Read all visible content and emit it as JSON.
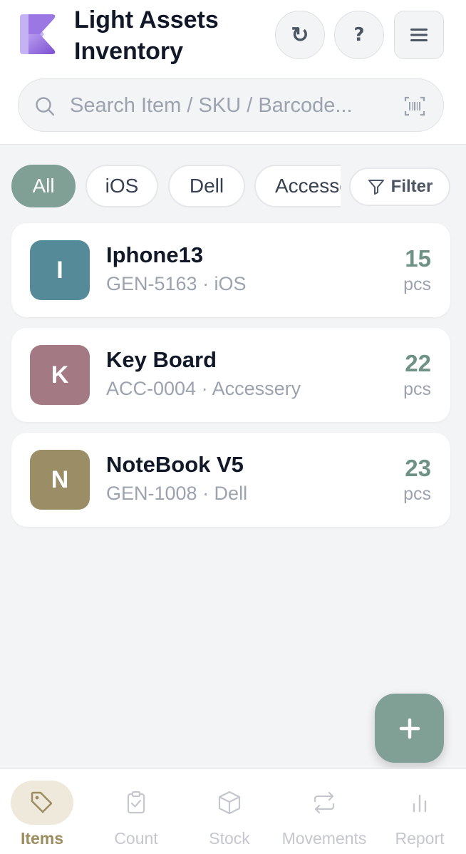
{
  "header": {
    "title": "Light Assets Inventory",
    "refresh_glyph": "↻",
    "help_glyph": "?",
    "menu_icon": "menu-icon"
  },
  "search": {
    "placeholder": "Search Item / SKU / Barcode...",
    "value": "",
    "scan_icon": "barcode-scan-icon"
  },
  "filters": {
    "chips": [
      {
        "label": "All",
        "active": true
      },
      {
        "label": "iOS",
        "active": false
      },
      {
        "label": "Dell",
        "active": false
      },
      {
        "label": "Accessery",
        "active": false
      }
    ],
    "filter_label": "Filter"
  },
  "items": [
    {
      "initial": "I",
      "name": "Iphone13",
      "sku": "GEN-5163 · iOS",
      "qty": "15",
      "unit": "pcs",
      "color": "#558a99"
    },
    {
      "initial": "K",
      "name": "Key Board",
      "sku": "ACC-0004 · Accessery",
      "qty": "22",
      "unit": "pcs",
      "color": "#a37a84"
    },
    {
      "initial": "N",
      "name": "NoteBook V5",
      "sku": "GEN-1008 · Dell",
      "qty": "23",
      "unit": "pcs",
      "color": "#9b8e66"
    }
  ],
  "fab": {
    "icon": "plus-icon"
  },
  "tabs": [
    {
      "label": "Items",
      "icon": "tag-icon",
      "active": true
    },
    {
      "label": "Count",
      "icon": "clipboard-check-icon",
      "active": false
    },
    {
      "label": "Stock",
      "icon": "box-icon",
      "active": false
    },
    {
      "label": "Movements",
      "icon": "transfer-arrows-icon",
      "active": false
    },
    {
      "label": "Report",
      "icon": "bar-chart-icon",
      "active": false
    }
  ],
  "colors": {
    "accent": "#80a096",
    "qty": "#6f9286",
    "tab_active": "#9b8b5e",
    "tab_active_bg": "#efe9dc"
  }
}
